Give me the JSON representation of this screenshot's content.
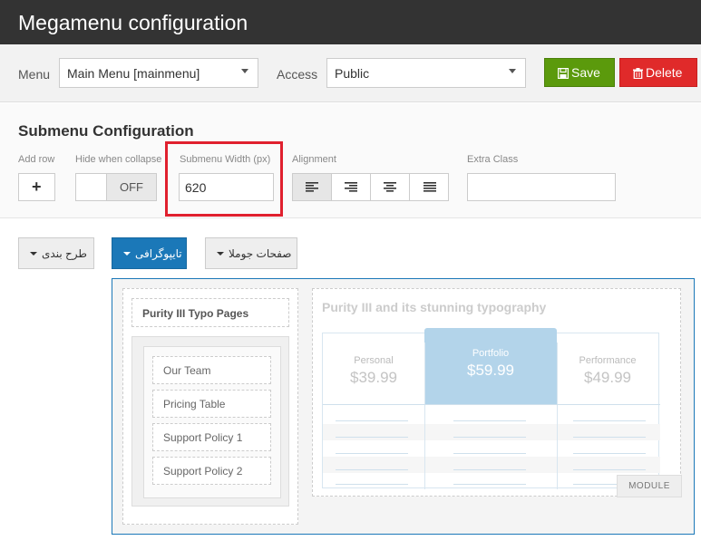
{
  "app": {
    "title": "Megamenu configuration"
  },
  "toolbar": {
    "menu_label": "Menu",
    "menu_value": "Main Menu [mainmenu]",
    "access_label": "Access",
    "access_value": "Public",
    "save_label": "Save",
    "delete_label": "Delete",
    "save_color": "#5b9a0c",
    "delete_color": "#e02a2a"
  },
  "submenu": {
    "heading": "Submenu Configuration",
    "add_row_label": "Add row",
    "add_row_symbol": "+",
    "hide_collapse_label": "Hide when collapse",
    "hide_collapse_state": "OFF",
    "width_label": "Submenu Width (px)",
    "width_value": "620",
    "alignment_label": "Alignment",
    "alignment_options": [
      "align-left-icon",
      "align-right-icon",
      "align-center-icon",
      "align-justify-icon"
    ],
    "extra_class_label": "Extra Class",
    "extra_class_value": ""
  },
  "menu_items": [
    {
      "label": "طرح بندی",
      "active": false
    },
    {
      "label": "تایپوگرافی",
      "active": true
    },
    {
      "label": "صفحات جوملا",
      "active": false
    }
  ],
  "megamenu": {
    "column1_title": "Purity III Typo Pages",
    "column1_items": [
      "Our Team",
      "Pricing Table",
      "Support Policy 1",
      "Support Policy 2"
    ],
    "column2_title": "Purity III and its stunning typography",
    "pricing": [
      {
        "name": "Personal",
        "price": "$39.99"
      },
      {
        "name": "Portfolio",
        "price": "$59.99"
      },
      {
        "name": "Performance",
        "price": "$49.99"
      }
    ],
    "module_tag": "MODULE"
  },
  "colors": {
    "accent": "#1b78b8",
    "highlight_box": "#e0202e",
    "titlebar": "#333333"
  }
}
